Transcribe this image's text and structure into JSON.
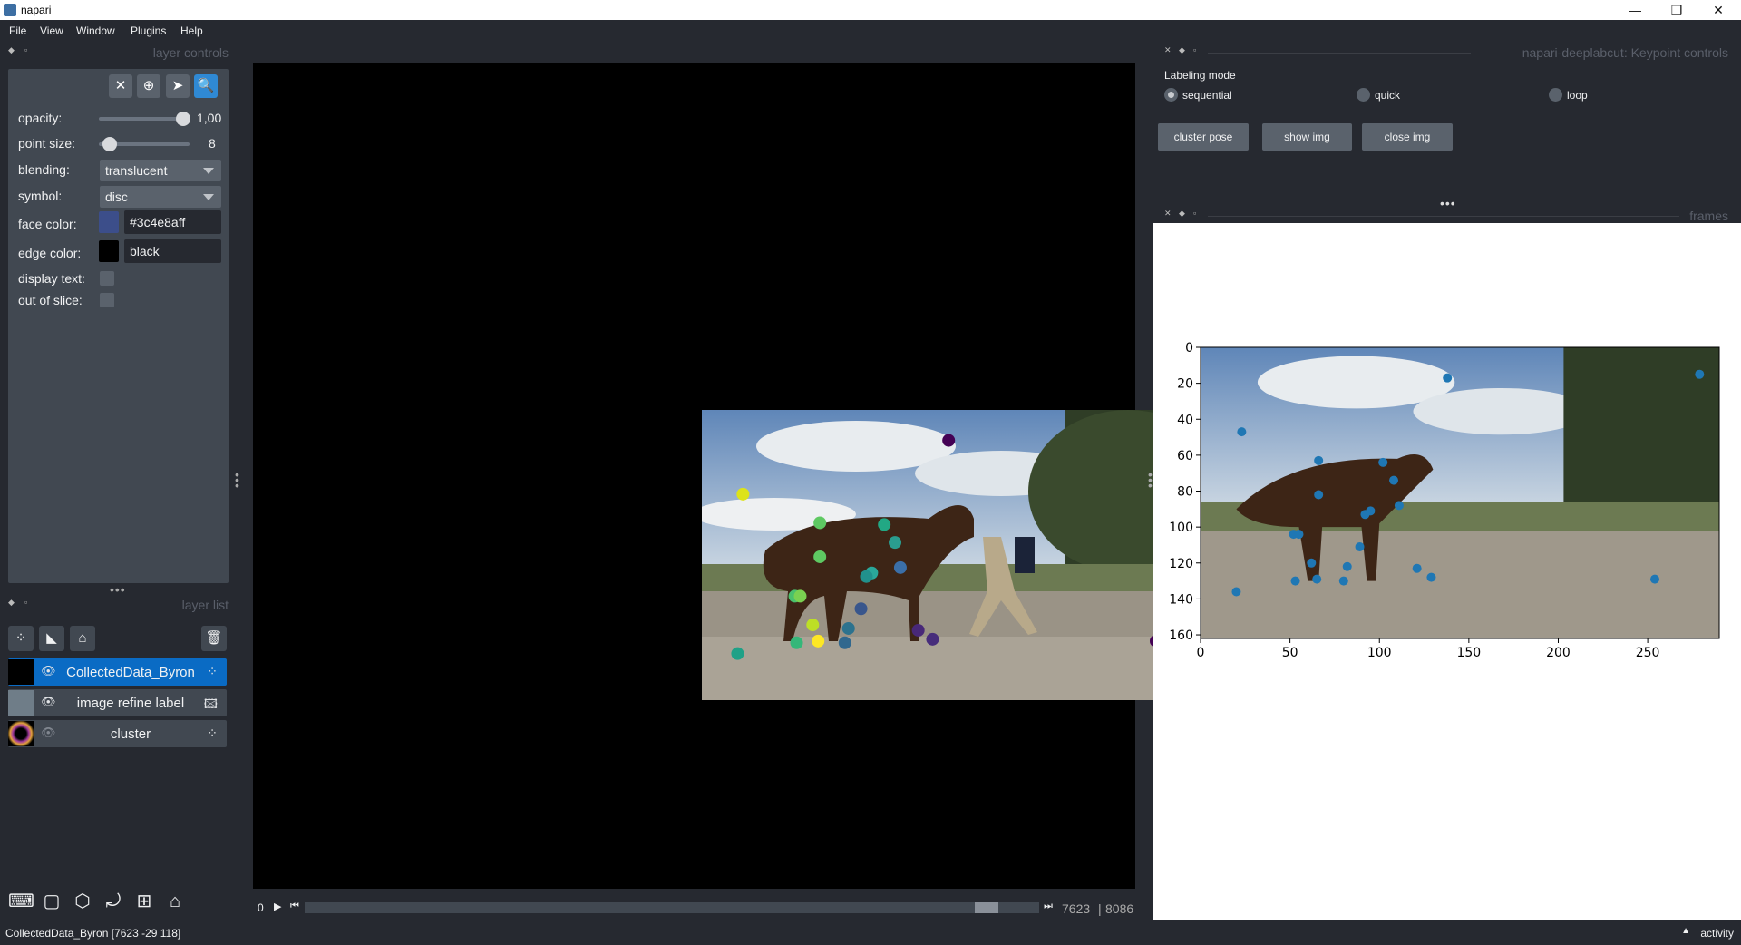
{
  "window": {
    "title": "napari",
    "minimize": "—",
    "maximize": "❐",
    "close": "✕"
  },
  "menu": [
    "File",
    "View",
    "Window",
    "Plugins",
    "Help"
  ],
  "layer_controls": {
    "header": "layer controls",
    "opacity_label": "opacity:",
    "opacity_value": "1,00",
    "opacity": 1.0,
    "point_size_label": "point size:",
    "point_size_value": "8",
    "point_size": 8,
    "blending_label": "blending:",
    "blending_value": "translucent",
    "symbol_label": "symbol:",
    "symbol_value": "disc",
    "face_color_label": "face color:",
    "face_color_value": "#3c4e8aff",
    "face_color": "#3c4e8a",
    "edge_color_label": "edge color:",
    "edge_color_value": "black",
    "edge_color": "#000000",
    "display_text_label": "display text:",
    "out_of_slice_label": "out of slice:"
  },
  "layer_list": {
    "header": "layer list",
    "layers": [
      {
        "name": "CollectedData_Byron",
        "visible": true,
        "type_icon": "points-icon",
        "selected": true
      },
      {
        "name": "image refine label",
        "visible": true,
        "type_icon": "image-icon",
        "selected": false
      },
      {
        "name": "cluster",
        "visible": false,
        "type_icon": "points-icon",
        "selected": false
      }
    ]
  },
  "dims": {
    "start": "0",
    "current": "7623",
    "total": "8086",
    "position": 0.9427
  },
  "status": {
    "text": "CollectedData_Byron [7623 -29 118]",
    "activity": "activity"
  },
  "keypoint_controls": {
    "header": "napari-deeplabcut: Keypoint controls",
    "labeling_mode_label": "Labeling mode",
    "modes": [
      "sequential",
      "quick",
      "loop"
    ],
    "selected_mode": "sequential",
    "buttons": [
      "cluster pose",
      "show img",
      "close img"
    ]
  },
  "frames_panel": {
    "header": "frames"
  },
  "chart_data": {
    "type": "scatter",
    "title": "",
    "xlabel": "",
    "ylabel": "",
    "xlim": [
      0,
      290
    ],
    "ylim": [
      162,
      0
    ],
    "xticks": [
      0,
      50,
      100,
      150,
      200,
      250
    ],
    "yticks": [
      0,
      20,
      40,
      60,
      80,
      100,
      120,
      140,
      160
    ],
    "marker_color": "#1f77b4",
    "points": [
      {
        "x": 138,
        "y": 17
      },
      {
        "x": 279,
        "y": 15
      },
      {
        "x": 23,
        "y": 47
      },
      {
        "x": 66,
        "y": 63
      },
      {
        "x": 102,
        "y": 64
      },
      {
        "x": 108,
        "y": 74
      },
      {
        "x": 66,
        "y": 82
      },
      {
        "x": 111,
        "y": 88
      },
      {
        "x": 95,
        "y": 91
      },
      {
        "x": 92,
        "y": 93
      },
      {
        "x": 52,
        "y": 104
      },
      {
        "x": 55,
        "y": 104
      },
      {
        "x": 89,
        "y": 111
      },
      {
        "x": 62,
        "y": 120
      },
      {
        "x": 82,
        "y": 122
      },
      {
        "x": 121,
        "y": 123
      },
      {
        "x": 129,
        "y": 128
      },
      {
        "x": 65,
        "y": 129
      },
      {
        "x": 80,
        "y": 130
      },
      {
        "x": 53,
        "y": 130
      },
      {
        "x": 254,
        "y": 129
      },
      {
        "x": 20,
        "y": 136
      }
    ]
  },
  "canvas_points": [
    {
      "x": 138,
      "y": 17,
      "color": "#440154"
    },
    {
      "x": 279,
      "y": 15,
      "color": "#3b528b"
    },
    {
      "x": 23,
      "y": 47,
      "color": "#dde318"
    },
    {
      "x": 66,
      "y": 63,
      "color": "#5ec962"
    },
    {
      "x": 102,
      "y": 64,
      "color": "#22a884"
    },
    {
      "x": 108,
      "y": 74,
      "color": "#2a9d8f"
    },
    {
      "x": 66,
      "y": 82,
      "color": "#5ec962"
    },
    {
      "x": 111,
      "y": 88,
      "color": "#3b6fa8"
    },
    {
      "x": 95,
      "y": 91,
      "color": "#2aa89a"
    },
    {
      "x": 92,
      "y": 93,
      "color": "#21918c"
    },
    {
      "x": 52,
      "y": 104,
      "color": "#4ac16d"
    },
    {
      "x": 55,
      "y": 104,
      "color": "#7ad151"
    },
    {
      "x": 89,
      "y": 111,
      "color": "#39568c"
    },
    {
      "x": 62,
      "y": 120,
      "color": "#bddf26"
    },
    {
      "x": 82,
      "y": 122,
      "color": "#2c728e"
    },
    {
      "x": 121,
      "y": 123,
      "color": "#482878"
    },
    {
      "x": 129,
      "y": 128,
      "color": "#472d7b"
    },
    {
      "x": 65,
      "y": 129,
      "color": "#fde725"
    },
    {
      "x": 80,
      "y": 130,
      "color": "#31688e"
    },
    {
      "x": 53,
      "y": 130,
      "color": "#35b779"
    },
    {
      "x": 254,
      "y": 129,
      "color": "#440154"
    },
    {
      "x": 20,
      "y": 136,
      "color": "#1fa187"
    }
  ]
}
